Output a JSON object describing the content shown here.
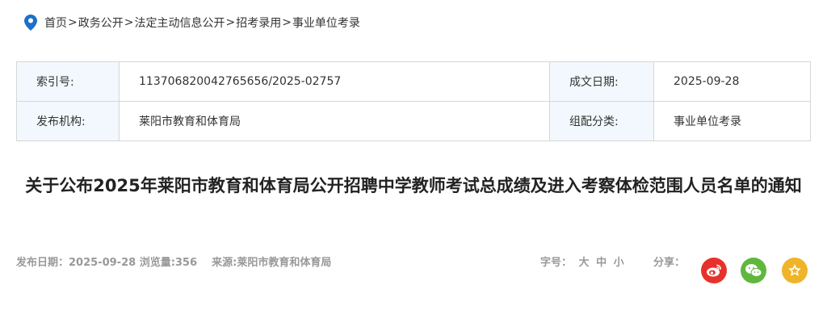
{
  "breadcrumb": {
    "items": [
      "首页",
      "政务公开",
      "法定主动信息公开",
      "招考录用",
      "事业单位考录"
    ],
    "separator": ">"
  },
  "meta": {
    "index_label": "索引号:",
    "index_value": "113706820042765656/2025-02757",
    "date_label": "成文日期:",
    "date_value": "2025-09-28",
    "org_label": "发布机构:",
    "org_value": "莱阳市教育和体育局",
    "category_label": "组配分类:",
    "category_value": "事业单位考录"
  },
  "article": {
    "title": "关于公布2025年莱阳市教育和体育局公开招聘中学教师考试总成绩及进入考察体检范围人员名单的通知",
    "publish_date": "发布日期：2025-09-28",
    "views": "浏览量:356",
    "source": "来源:莱阳市教育和体育局"
  },
  "font_size": {
    "label": "字号：",
    "large": "大",
    "medium": "中",
    "small": "小"
  },
  "share": {
    "label": "分享：",
    "icons": [
      "weibo-icon",
      "wechat-icon",
      "favorite-icon"
    ],
    "colors": {
      "weibo": "#e6322a",
      "wechat": "#5fb83d",
      "favorite": "#f0b429"
    }
  },
  "colors": {
    "accent": "#1e6fc9",
    "label_bg": "#f2f8fd"
  }
}
